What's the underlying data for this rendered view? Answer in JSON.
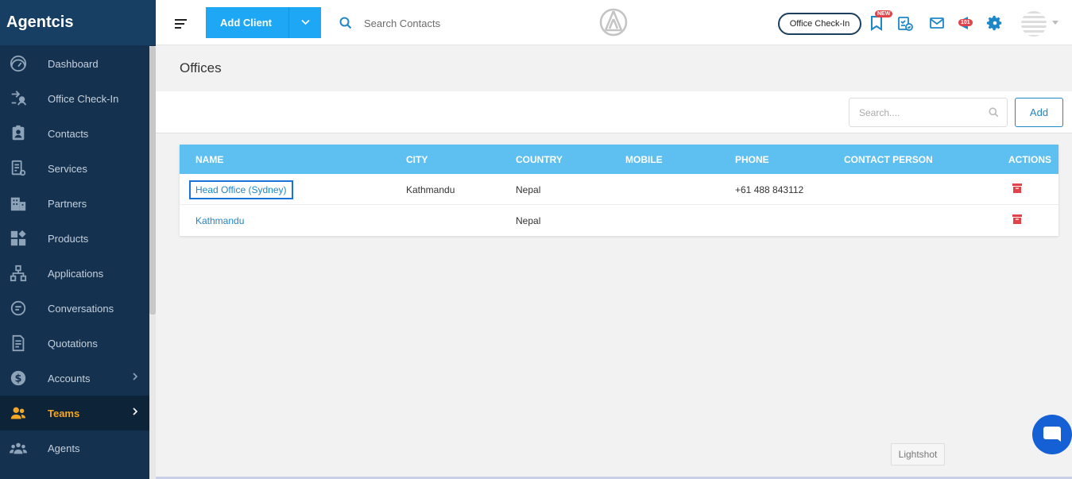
{
  "sidebar": {
    "brand": "Agentcis",
    "items": [
      {
        "label": "Dashboard",
        "icon": "dashboard-icon"
      },
      {
        "label": "Office Check-In",
        "icon": "check-in-icon"
      },
      {
        "label": "Contacts",
        "icon": "contacts-icon"
      },
      {
        "label": "Services",
        "icon": "services-icon"
      },
      {
        "label": "Partners",
        "icon": "partners-icon"
      },
      {
        "label": "Products",
        "icon": "products-icon"
      },
      {
        "label": "Applications",
        "icon": "applications-icon"
      },
      {
        "label": "Conversations",
        "icon": "conversations-icon"
      },
      {
        "label": "Quotations",
        "icon": "quotations-icon"
      },
      {
        "label": "Accounts",
        "icon": "accounts-icon"
      },
      {
        "label": "Teams",
        "icon": "teams-icon",
        "active": true
      },
      {
        "label": "Agents",
        "icon": "agents-icon"
      }
    ]
  },
  "topbar": {
    "add_client_label": "Add Client",
    "search_placeholder": "Search Contacts",
    "checkin_label": "Office Check-In",
    "new_badge": "NEW",
    "notif_count": "101"
  },
  "page": {
    "title": "Offices",
    "search_placeholder": "Search....",
    "add_label": "Add"
  },
  "table": {
    "headers": [
      "NAME",
      "CITY",
      "COUNTRY",
      "MOBILE",
      "PHONE",
      "CONTACT PERSON",
      "ACTIONS"
    ],
    "rows": [
      {
        "name": "Head Office (Sydney)",
        "city": "Kathmandu",
        "country": "Nepal",
        "mobile": "",
        "phone": "+61 488 843112",
        "contact_person": ""
      },
      {
        "name": "Kathmandu",
        "city": "",
        "country": "Nepal",
        "mobile": "",
        "phone": "",
        "contact_person": ""
      }
    ]
  },
  "overlay": {
    "lightshot": "Lightshot"
  },
  "colors": {
    "sidebar_bg": "#14324f",
    "accent_blue": "#1ea7f5",
    "table_header": "#5ec0f0",
    "active_orange": "#f5a623",
    "delete_red": "#e0434a"
  }
}
